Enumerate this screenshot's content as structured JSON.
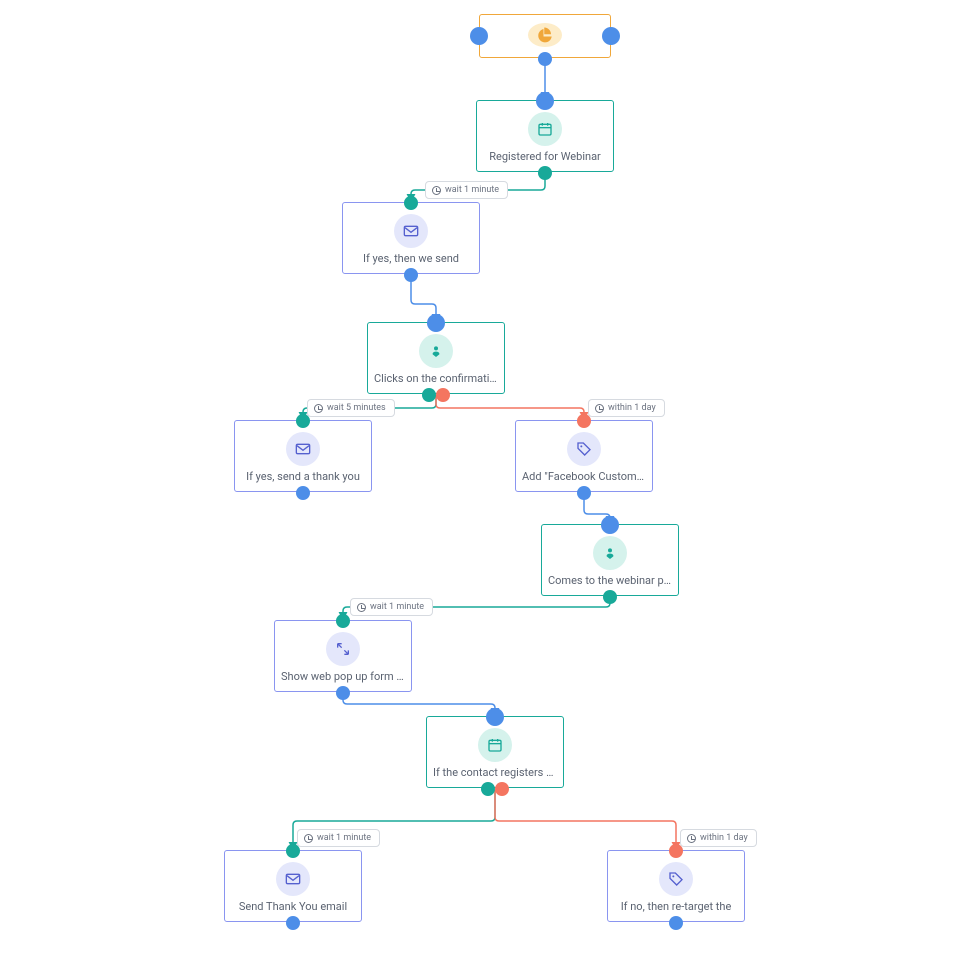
{
  "colors": {
    "start_border": "#f0a73a",
    "trigger_border": "#18a999",
    "action_border": "#8a95f0",
    "blue_dot": "#4d8ee8",
    "green_dot": "#18a999",
    "red_dot": "#f47560",
    "green_line": "#18a999",
    "blue_line": "#4d8ee8",
    "red_line": "#f47560"
  },
  "nodes": {
    "start": {
      "type": "start",
      "icon": "pie-chart-icon"
    },
    "registered": {
      "type": "trigger",
      "icon": "calendar-icon",
      "label": "Registered for Webinar"
    },
    "if_yes_send": {
      "type": "action",
      "icon": "envelope-icon",
      "label": "If yes, then we send"
    },
    "clicks_conf": {
      "type": "trigger",
      "icon": "person-pin-icon",
      "label": "Clicks on the confirmation"
    },
    "thank_you": {
      "type": "action",
      "icon": "envelope-icon",
      "label": "If yes, send a thank you"
    },
    "fb_ad": {
      "type": "action",
      "icon": "tag-icon",
      "label": "Add \"Facebook Custom Ad"
    },
    "webinar_page": {
      "type": "trigger",
      "icon": "person-pin-icon",
      "label": "Comes to the webinar page"
    },
    "popup": {
      "type": "action",
      "icon": "expand-icon",
      "label": "Show web pop up form as"
    },
    "if_registers": {
      "type": "trigger",
      "icon": "calendar-icon",
      "label": "If the contact registers for"
    },
    "send_thanks": {
      "type": "action",
      "icon": "envelope-icon",
      "label": "Send Thank You email"
    },
    "retarget": {
      "type": "action",
      "icon": "tag-icon",
      "label": "If no, then re-target the"
    }
  },
  "pills": {
    "p1": "wait 1 minute",
    "p2": "wait 5 minutes",
    "p3": "within 1 day",
    "p4": "wait 1 minute",
    "p5": "wait 1 minute",
    "p6": "within 1 day"
  }
}
